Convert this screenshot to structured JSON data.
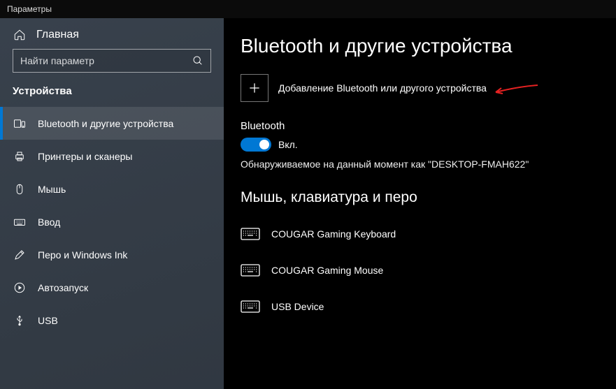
{
  "titlebar": {
    "title": "Параметры"
  },
  "sidebar": {
    "home_label": "Главная",
    "search_placeholder": "Найти параметр",
    "section_title": "Устройства",
    "items": [
      {
        "label": "Bluetooth и другие устройства"
      },
      {
        "label": "Принтеры и сканеры"
      },
      {
        "label": "Мышь"
      },
      {
        "label": "Ввод"
      },
      {
        "label": "Перо и Windows Ink"
      },
      {
        "label": "Автозапуск"
      },
      {
        "label": "USB"
      }
    ]
  },
  "main": {
    "page_title": "Bluetooth и другие устройства",
    "add_device_label": "Добавление Bluetooth или другого устройства",
    "bluetooth_heading": "Bluetooth",
    "toggle_state_label": "Вкл.",
    "discoverable_text": "Обнаруживаемое на данный момент как \"DESKTOP-FMAH622\"",
    "category_mouse_kbd": "Мышь, клавиатура и перо",
    "devices": [
      {
        "name": "COUGAR Gaming Keyboard"
      },
      {
        "name": "COUGAR Gaming Mouse"
      },
      {
        "name": "USB Device"
      }
    ]
  }
}
